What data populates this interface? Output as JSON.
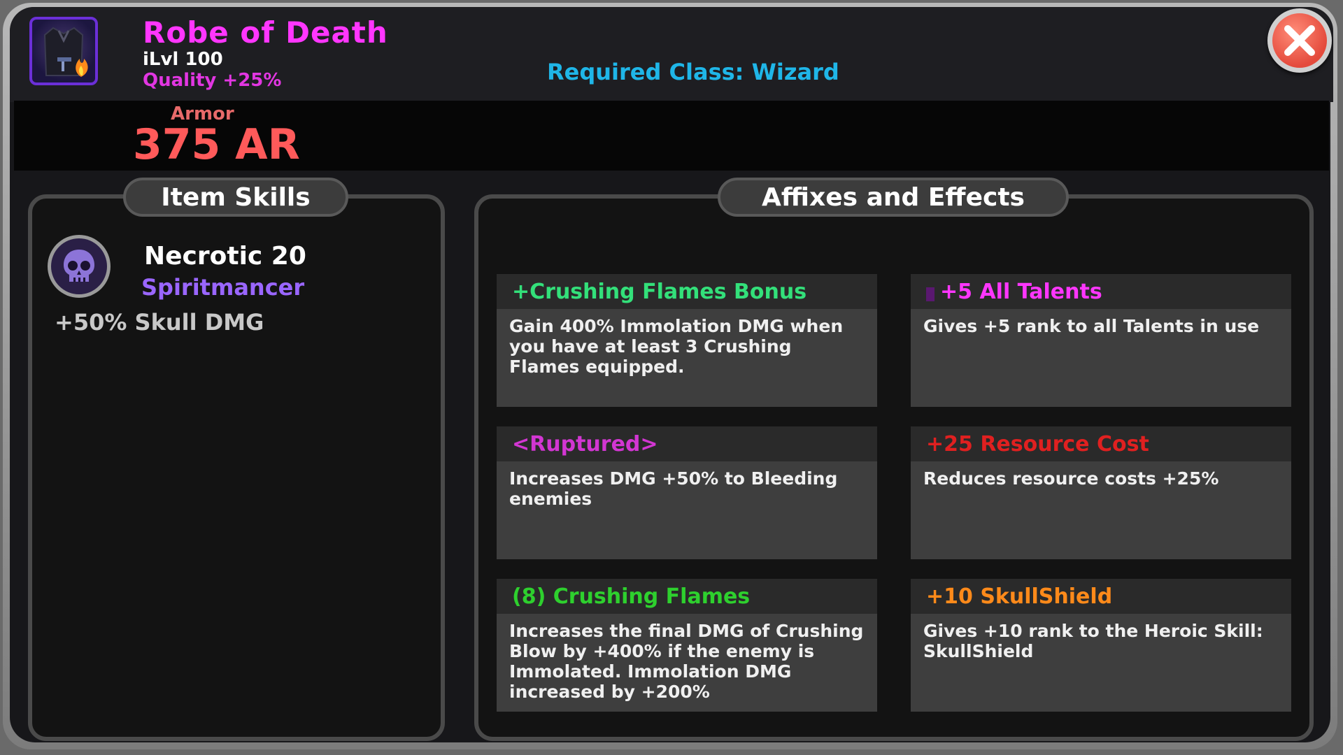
{
  "item": {
    "name": "Robe of Death",
    "ilvl": "iLvl 100",
    "quality": "Quality +25%",
    "required_class": "Required Class: Wizard",
    "armor_label": "Armor",
    "armor_value": "375 AR",
    "icon": "robe-icon"
  },
  "colors": {
    "item_name": "#ff36ff",
    "required_class": "#1fb6e8",
    "armor": "#ff5a5a",
    "close_button": "#e44a3c"
  },
  "tabs": {
    "skills": "Item Skills",
    "affixes": "Affixes and Effects"
  },
  "skill": {
    "name": "Necrotic 20",
    "class": "Spiritmancer",
    "bonus": "+50% Skull DMG",
    "icon": "skull-icon"
  },
  "affixes": [
    {
      "title": "+Crushing Flames Bonus",
      "color": "#33e07a",
      "desc": "Gain 400% Immolation DMG when you have at least 3 Crushing Flames equipped."
    },
    {
      "title": "+5 All Talents",
      "color": "#ff36ff",
      "desc": "Gives +5 rank to all Talents in use"
    },
    {
      "title": "<Ruptured>",
      "color": "#d236d2",
      "desc": "Increases DMG +50% to Bleeding enemies"
    },
    {
      "title": "+25 Resource Cost",
      "color": "#e02020",
      "desc": "Reduces resource costs +25%"
    },
    {
      "title": "(8) Crushing Flames",
      "color": "#2ed02e",
      "desc": "Increases the final DMG of Crushing Blow by +400% if the enemy is Immolated. Immolation DMG increased by +200%"
    },
    {
      "title": "+10 SkullShield",
      "color": "#ff8a1a",
      "desc": "Gives +10 rank to the Heroic Skill: SkullShield"
    }
  ]
}
